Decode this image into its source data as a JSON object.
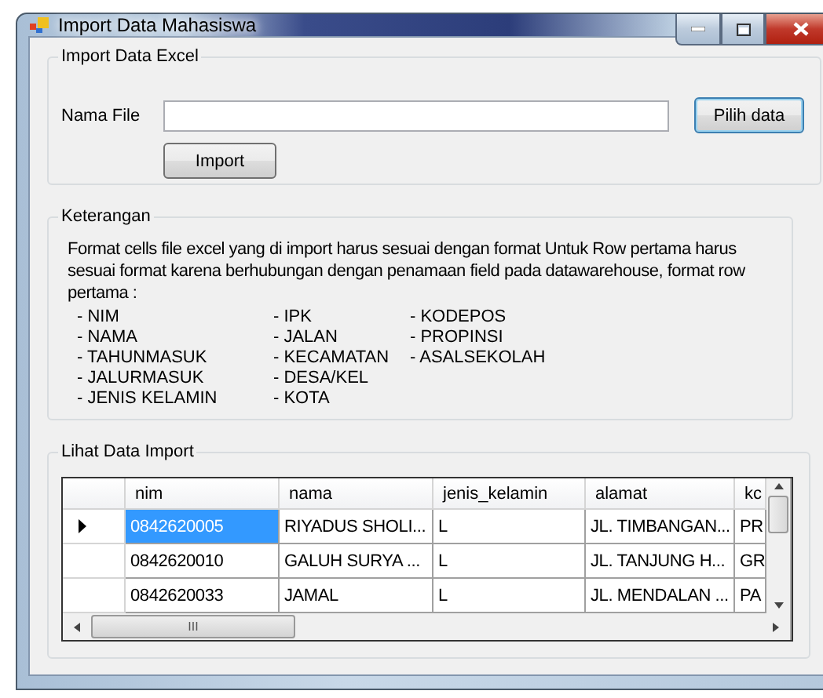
{
  "window": {
    "title": "Import Data Mahasiswa"
  },
  "import_group": {
    "title": "Import Data Excel",
    "file_label": "Nama File",
    "browse_button": "Pilih data",
    "import_button": "Import"
  },
  "info_group": {
    "title": "Keterangan",
    "text": "Format cells file excel yang di import harus sesuai dengan format Untuk Row pertama harus sesuai format karena berhubungan dengan penamaan field pada datawarehouse, format row pertama :",
    "columns": [
      [
        "- NIM",
        "- NAMA",
        "- TAHUNMASUK",
        "- JALURMASUK",
        "- JENIS KELAMIN"
      ],
      [
        "- IPK",
        "- JALAN",
        "- KECAMATAN",
        "- DESA/KEL",
        "- KOTA"
      ],
      [
        "- KODEPOS",
        "- PROPINSI",
        "- ASALSEKOLAH"
      ]
    ]
  },
  "data_group": {
    "title": "Lihat Data Import",
    "table": {
      "columns": [
        "nim",
        "nama",
        "jenis_kelamin",
        "alamat",
        "kc"
      ],
      "rows": [
        {
          "selected": true,
          "cells": [
            "0842620005",
            "RIYADUS SHOLI...",
            "L",
            "JL. TIMBANGAN...",
            "PR"
          ]
        },
        {
          "selected": false,
          "cells": [
            "0842620010",
            "GALUH SURYA ...",
            "L",
            "JL. TANJUNG H...",
            "GR"
          ]
        },
        {
          "selected": false,
          "cells": [
            "0842620033",
            "JAMAL",
            "L",
            "JL. MENDALAN ...",
            "PA"
          ]
        }
      ],
      "scroll_thumb_glyph": "III"
    }
  }
}
